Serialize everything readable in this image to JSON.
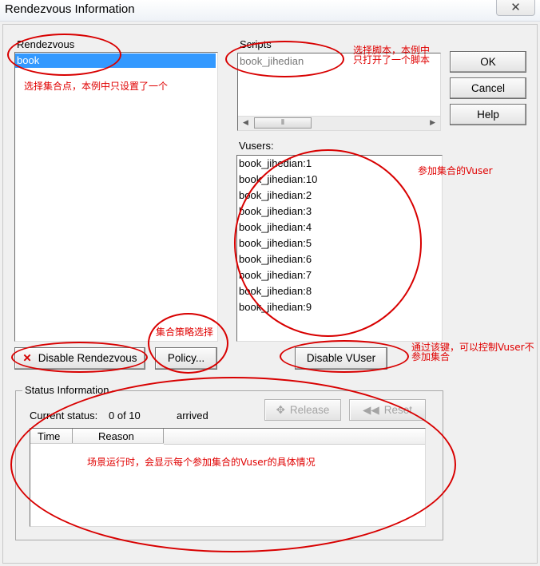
{
  "window": {
    "title": "Rendezvous Information",
    "close_label": "✕"
  },
  "rendezvous": {
    "label": "Rendezvous",
    "items": [
      {
        "label": "book",
        "selected": true
      }
    ]
  },
  "scripts": {
    "label": "Scripts",
    "items": [
      {
        "label": "book_jihedian"
      }
    ]
  },
  "vusers": {
    "label": "Vusers:",
    "items": [
      "book_jihedian:1",
      "book_jihedian:10",
      "book_jihedian:2",
      "book_jihedian:3",
      "book_jihedian:4",
      "book_jihedian:5",
      "book_jihedian:6",
      "book_jihedian:7",
      "book_jihedian:8",
      "book_jihedian:9"
    ]
  },
  "buttons": {
    "ok": "OK",
    "cancel": "Cancel",
    "help": "Help",
    "disable_rendezvous": "Disable Rendezvous",
    "policy": "Policy...",
    "disable_vuser": "Disable VUser",
    "release": "Release",
    "reset": "Reset"
  },
  "status": {
    "group_label": "Status Information",
    "current_label": "Current status:",
    "count": "0 of 10",
    "state": "arrived",
    "columns": [
      "Time",
      "Reason"
    ]
  },
  "annotations": {
    "rendezvous_note": "选择集合点，本例中只设置了一个",
    "scripts_note_1": "选择脚本，本例中",
    "scripts_note_2": "只打开了一个脚本",
    "vusers_note": "参加集合的Vuser",
    "policy_note": "集合策略选择",
    "disable_note_1": "通过该键，可以控制Vuser不",
    "disable_note_2": "参加集合",
    "status_note": "场景运行时，会显示每个参加集合的Vuser的具体情况"
  },
  "colors": {
    "selection": "#3399ff",
    "annotation": "#e00000"
  },
  "icons": {
    "disable": "red-x-icon",
    "release": "release-icon",
    "reset": "rewind-icon"
  }
}
